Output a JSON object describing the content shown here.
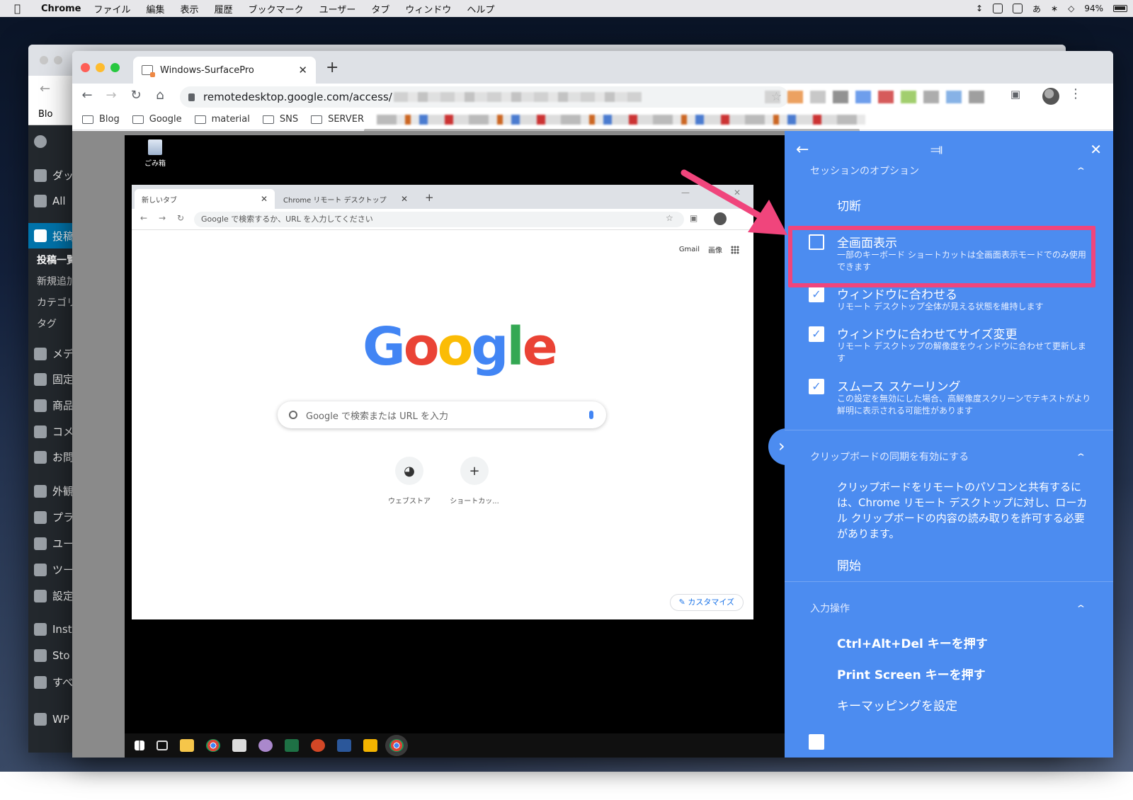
{
  "menubar": {
    "app": "Chrome",
    "items": [
      "ファイル",
      "編集",
      "表示",
      "履歴",
      "ブックマーク",
      "ユーザー",
      "タブ",
      "ウィンドウ",
      "ヘルプ"
    ],
    "ime": "あ",
    "battery": "94%"
  },
  "back_window": {
    "bookmark": "Blo",
    "wp_menu": [
      "ダッ",
      "All",
      "投稿",
      "投稿一覧",
      "新規追加",
      "カテゴリ",
      "タグ",
      "メデ",
      "固定",
      "商品",
      "コメ",
      "お問",
      "外観",
      "プラ",
      "ユー",
      "ツー",
      "設定",
      "Inst",
      "Sto",
      "すべ",
      "WP"
    ],
    "wp_active": "投稿"
  },
  "browser": {
    "tab_title": "Windows-SurfacePro",
    "url": "remotedesktop.google.com/access/",
    "bookmarks": [
      "Blog",
      "Google",
      "material",
      "SNS",
      "SERVER"
    ]
  },
  "remote": {
    "desktop_icon": "ごみ箱",
    "inner_tabs": [
      "新しいタブ",
      "Chrome リモート デスクトップ"
    ],
    "inner_omni_placeholder": "Google で検索するか、URL を入力してください",
    "top_links": [
      "Gmail",
      "画像"
    ],
    "search_placeholder": "Google で検索または URL を入力",
    "shortcuts": [
      "ウェブストア",
      "ショートカッ..."
    ],
    "customize": "カスタマイズ"
  },
  "panel": {
    "session_header": "セッションのオプション",
    "disconnect": "切断",
    "options": [
      {
        "title": "全画面表示",
        "desc": "一部のキーボード ショートカットは全画面表示モードでのみ使用できます",
        "checked": false
      },
      {
        "title": "ウィンドウに合わせる",
        "desc": "リモート デスクトップ全体が見える状態を維持します",
        "checked": true
      },
      {
        "title": "ウィンドウに合わせてサイズ変更",
        "desc": "リモート デスクトップの解像度をウィンドウに合わせて更新します",
        "checked": true
      },
      {
        "title": "スムース スケーリング",
        "desc": "この設定を無効にした場合、高解像度スクリーンでテキストがより鮮明に表示される可能性があります",
        "checked": true
      }
    ],
    "clipboard_header": "クリップボードの同期を有効にする",
    "clipboard_text": "クリップボードをリモートのパソコンと共有するには、Chrome リモート デスクトップに対し、ローカル クリップボードの内容の読み取りを許可する必要があります。",
    "clipboard_start": "開始",
    "input_header": "入力操作",
    "input_items": [
      "Ctrl+Alt+Del キーを押す",
      "Print Screen キーを押す",
      "キーマッピングを設定"
    ]
  },
  "colors": {
    "panel": "#4c8cf0",
    "highlight": "#f0457c",
    "wp_sidebar": "#23282d",
    "wp_active": "#0073aa"
  }
}
